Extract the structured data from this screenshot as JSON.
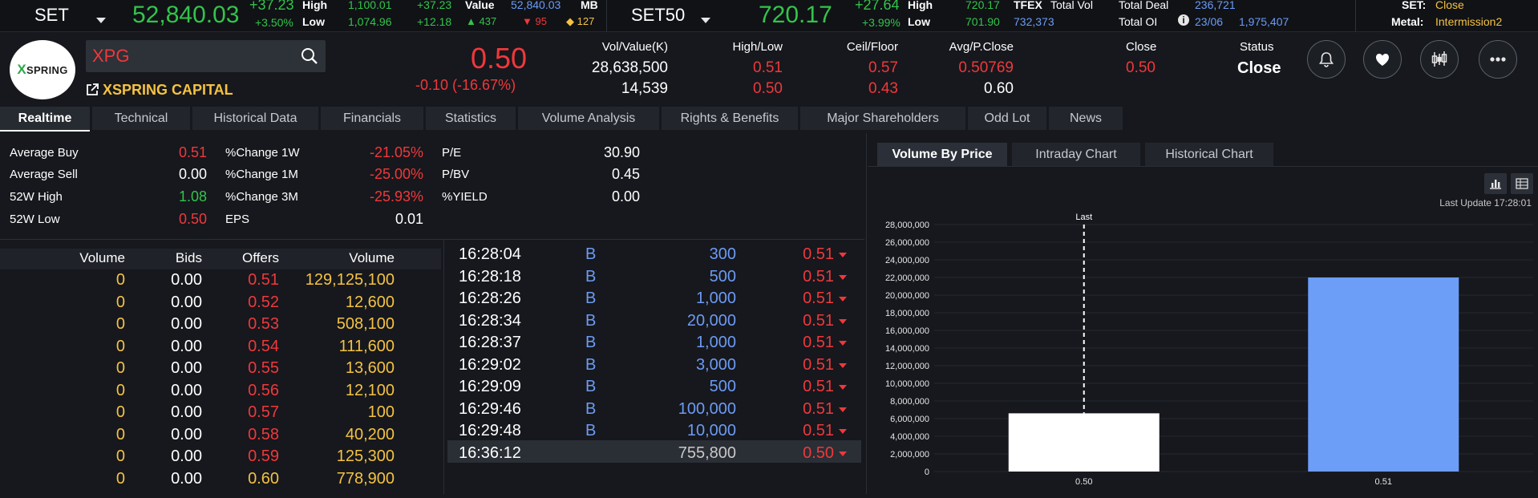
{
  "top": {
    "set": {
      "name": "SET",
      "value": "52,840.03",
      "change": "+37.23",
      "pct": "+3.50%",
      "high_label": "High",
      "low_label": "Low",
      "high": "1,100.01",
      "low": "1,074.96",
      "high_chg": "+37.23",
      "low_chg": "+12.18",
      "up": "437",
      "down": "95",
      "unch": "127",
      "value_label": "Value",
      "value_unit": "MB"
    },
    "set50": {
      "name": "SET50",
      "value": "720.17",
      "change": "+27.64",
      "pct": "+3.99%",
      "high_label": "High",
      "low_label": "Low",
      "high": "720.17",
      "low": "701.90"
    },
    "tfex": {
      "label": "TFEX",
      "total_vol_label": "Total Vol",
      "total_vol": "732,373",
      "total_deal_label": "Total Deal",
      "total_deal": "236,721",
      "total_oi_label": "Total OI",
      "oi_date": "23/06",
      "total_oi": "1,975,407"
    },
    "status": {
      "set_label": "SET:",
      "set_value": "Close",
      "metal_label": "Metal:",
      "metal_value": "Intermission2"
    }
  },
  "stock": {
    "logo_text": "SPRING",
    "logo_letter": "X",
    "symbol": "XPG",
    "company": "XSPRING CAPITAL",
    "price": "0.50",
    "change": "-0.10 (-16.67%)",
    "vol_label": "Vol/Value(K)",
    "vol": "28,638,500",
    "value": "14,539",
    "hl_label": "High/Low",
    "high": "0.51",
    "low": "0.50",
    "cf_label": "Ceil/Floor",
    "ceil": "0.57",
    "floor": "0.43",
    "avg_label": "Avg/P.Close",
    "avg": "0.50769",
    "pclose": "0.60",
    "close_label": "Close",
    "close": "0.50",
    "status_label": "Status",
    "status": "Close"
  },
  "tabs": [
    "Realtime",
    "Technical",
    "Historical Data",
    "Financials",
    "Statistics",
    "Volume Analysis",
    "Rights & Benefits",
    "Major Shareholders",
    "Odd Lot",
    "News"
  ],
  "stats": {
    "left": [
      {
        "label": "Average Buy",
        "value": "0.51",
        "color": "red"
      },
      {
        "label": "Average Sell",
        "value": "0.00",
        "color": "white"
      },
      {
        "label": "52W High",
        "value": "1.08",
        "color": "green"
      },
      {
        "label": "52W Low",
        "value": "0.50",
        "color": "red"
      }
    ],
    "mid": [
      {
        "label": "%Change 1W",
        "value": "-21.05%"
      },
      {
        "label": "%Change 1M",
        "value": "-25.00%"
      },
      {
        "label": "%Change 3M",
        "value": "-25.93%"
      },
      {
        "label": "EPS",
        "value": "0.01"
      }
    ],
    "right": [
      {
        "label": "P/E",
        "value": "30.90"
      },
      {
        "label": "P/BV",
        "value": "0.45"
      },
      {
        "label": "%YIELD",
        "value": "0.00"
      }
    ]
  },
  "bidoffer": {
    "headers": [
      "Volume",
      "Bids",
      "Offers",
      "Volume"
    ],
    "rows": [
      {
        "bvol": "0",
        "bid": "0.00",
        "offer": "0.51",
        "ovol": "129,125,100"
      },
      {
        "bvol": "0",
        "bid": "0.00",
        "offer": "0.52",
        "ovol": "12,600"
      },
      {
        "bvol": "0",
        "bid": "0.00",
        "offer": "0.53",
        "ovol": "508,100"
      },
      {
        "bvol": "0",
        "bid": "0.00",
        "offer": "0.54",
        "ovol": "111,600"
      },
      {
        "bvol": "0",
        "bid": "0.00",
        "offer": "0.55",
        "ovol": "13,600"
      },
      {
        "bvol": "0",
        "bid": "0.00",
        "offer": "0.56",
        "ovol": "12,100"
      },
      {
        "bvol": "0",
        "bid": "0.00",
        "offer": "0.57",
        "ovol": "100"
      },
      {
        "bvol": "0",
        "bid": "0.00",
        "offer": "0.58",
        "ovol": "40,200"
      },
      {
        "bvol": "0",
        "bid": "0.00",
        "offer": "0.59",
        "ovol": "125,300"
      },
      {
        "bvol": "0",
        "bid": "0.00",
        "offer": "0.60",
        "ovol": "778,900"
      }
    ]
  },
  "ticker": [
    {
      "time": "16:28:04",
      "side": "B",
      "vol": "300",
      "price": "0.51"
    },
    {
      "time": "16:28:18",
      "side": "B",
      "vol": "500",
      "price": "0.51"
    },
    {
      "time": "16:28:26",
      "side": "B",
      "vol": "1,000",
      "price": "0.51"
    },
    {
      "time": "16:28:34",
      "side": "B",
      "vol": "20,000",
      "price": "0.51"
    },
    {
      "time": "16:28:37",
      "side": "B",
      "vol": "1,000",
      "price": "0.51"
    },
    {
      "time": "16:29:02",
      "side": "B",
      "vol": "3,000",
      "price": "0.51"
    },
    {
      "time": "16:29:09",
      "side": "B",
      "vol": "500",
      "price": "0.51"
    },
    {
      "time": "16:29:46",
      "side": "B",
      "vol": "100,000",
      "price": "0.51"
    },
    {
      "time": "16:29:48",
      "side": "B",
      "vol": "10,000",
      "price": "0.51"
    },
    {
      "time": "16:36:12",
      "side": "",
      "vol": "755,800",
      "price": "0.50"
    }
  ],
  "chart_tabs": [
    "Volume By Price",
    "Intraday Chart",
    "Historical Chart"
  ],
  "chart": {
    "last_update": "Last Update 17:28:01",
    "last_label": "Last"
  },
  "chart_data": {
    "type": "bar",
    "categories": [
      "0.50",
      "0.51"
    ],
    "values": [
      6600000,
      22000000
    ],
    "colors": [
      "#ffffff",
      "#6c9ef8"
    ],
    "ylim": [
      0,
      28000000
    ],
    "yticks": [
      "0",
      "2,000,000",
      "4,000,000",
      "6,000,000",
      "8,000,000",
      "10,000,000",
      "12,000,000",
      "14,000,000",
      "16,000,000",
      "18,000,000",
      "20,000,000",
      "22,000,000",
      "24,000,000",
      "26,000,000",
      "28,000,000"
    ],
    "last_marker": "0.50"
  }
}
